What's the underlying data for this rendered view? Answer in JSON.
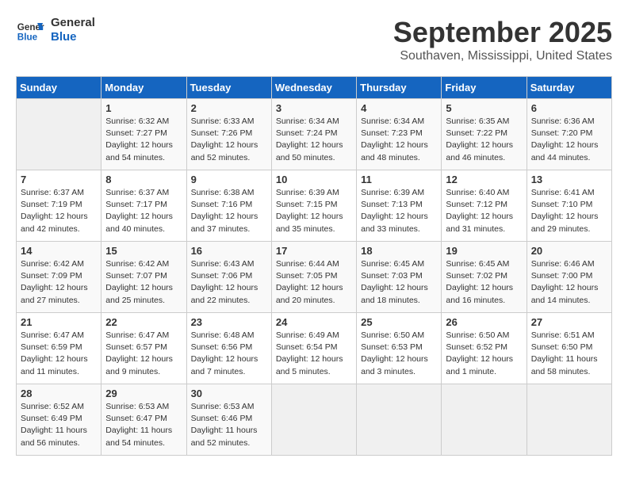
{
  "header": {
    "logo_line1": "General",
    "logo_line2": "Blue",
    "month": "September 2025",
    "location": "Southaven, Mississippi, United States"
  },
  "weekdays": [
    "Sunday",
    "Monday",
    "Tuesday",
    "Wednesday",
    "Thursday",
    "Friday",
    "Saturday"
  ],
  "weeks": [
    [
      {
        "day": "",
        "info": ""
      },
      {
        "day": "1",
        "info": "Sunrise: 6:32 AM\nSunset: 7:27 PM\nDaylight: 12 hours\nand 54 minutes."
      },
      {
        "day": "2",
        "info": "Sunrise: 6:33 AM\nSunset: 7:26 PM\nDaylight: 12 hours\nand 52 minutes."
      },
      {
        "day": "3",
        "info": "Sunrise: 6:34 AM\nSunset: 7:24 PM\nDaylight: 12 hours\nand 50 minutes."
      },
      {
        "day": "4",
        "info": "Sunrise: 6:34 AM\nSunset: 7:23 PM\nDaylight: 12 hours\nand 48 minutes."
      },
      {
        "day": "5",
        "info": "Sunrise: 6:35 AM\nSunset: 7:22 PM\nDaylight: 12 hours\nand 46 minutes."
      },
      {
        "day": "6",
        "info": "Sunrise: 6:36 AM\nSunset: 7:20 PM\nDaylight: 12 hours\nand 44 minutes."
      }
    ],
    [
      {
        "day": "7",
        "info": "Sunrise: 6:37 AM\nSunset: 7:19 PM\nDaylight: 12 hours\nand 42 minutes."
      },
      {
        "day": "8",
        "info": "Sunrise: 6:37 AM\nSunset: 7:17 PM\nDaylight: 12 hours\nand 40 minutes."
      },
      {
        "day": "9",
        "info": "Sunrise: 6:38 AM\nSunset: 7:16 PM\nDaylight: 12 hours\nand 37 minutes."
      },
      {
        "day": "10",
        "info": "Sunrise: 6:39 AM\nSunset: 7:15 PM\nDaylight: 12 hours\nand 35 minutes."
      },
      {
        "day": "11",
        "info": "Sunrise: 6:39 AM\nSunset: 7:13 PM\nDaylight: 12 hours\nand 33 minutes."
      },
      {
        "day": "12",
        "info": "Sunrise: 6:40 AM\nSunset: 7:12 PM\nDaylight: 12 hours\nand 31 minutes."
      },
      {
        "day": "13",
        "info": "Sunrise: 6:41 AM\nSunset: 7:10 PM\nDaylight: 12 hours\nand 29 minutes."
      }
    ],
    [
      {
        "day": "14",
        "info": "Sunrise: 6:42 AM\nSunset: 7:09 PM\nDaylight: 12 hours\nand 27 minutes."
      },
      {
        "day": "15",
        "info": "Sunrise: 6:42 AM\nSunset: 7:07 PM\nDaylight: 12 hours\nand 25 minutes."
      },
      {
        "day": "16",
        "info": "Sunrise: 6:43 AM\nSunset: 7:06 PM\nDaylight: 12 hours\nand 22 minutes."
      },
      {
        "day": "17",
        "info": "Sunrise: 6:44 AM\nSunset: 7:05 PM\nDaylight: 12 hours\nand 20 minutes."
      },
      {
        "day": "18",
        "info": "Sunrise: 6:45 AM\nSunset: 7:03 PM\nDaylight: 12 hours\nand 18 minutes."
      },
      {
        "day": "19",
        "info": "Sunrise: 6:45 AM\nSunset: 7:02 PM\nDaylight: 12 hours\nand 16 minutes."
      },
      {
        "day": "20",
        "info": "Sunrise: 6:46 AM\nSunset: 7:00 PM\nDaylight: 12 hours\nand 14 minutes."
      }
    ],
    [
      {
        "day": "21",
        "info": "Sunrise: 6:47 AM\nSunset: 6:59 PM\nDaylight: 12 hours\nand 11 minutes."
      },
      {
        "day": "22",
        "info": "Sunrise: 6:47 AM\nSunset: 6:57 PM\nDaylight: 12 hours\nand 9 minutes."
      },
      {
        "day": "23",
        "info": "Sunrise: 6:48 AM\nSunset: 6:56 PM\nDaylight: 12 hours\nand 7 minutes."
      },
      {
        "day": "24",
        "info": "Sunrise: 6:49 AM\nSunset: 6:54 PM\nDaylight: 12 hours\nand 5 minutes."
      },
      {
        "day": "25",
        "info": "Sunrise: 6:50 AM\nSunset: 6:53 PM\nDaylight: 12 hours\nand 3 minutes."
      },
      {
        "day": "26",
        "info": "Sunrise: 6:50 AM\nSunset: 6:52 PM\nDaylight: 12 hours\nand 1 minute."
      },
      {
        "day": "27",
        "info": "Sunrise: 6:51 AM\nSunset: 6:50 PM\nDaylight: 11 hours\nand 58 minutes."
      }
    ],
    [
      {
        "day": "28",
        "info": "Sunrise: 6:52 AM\nSunset: 6:49 PM\nDaylight: 11 hours\nand 56 minutes."
      },
      {
        "day": "29",
        "info": "Sunrise: 6:53 AM\nSunset: 6:47 PM\nDaylight: 11 hours\nand 54 minutes."
      },
      {
        "day": "30",
        "info": "Sunrise: 6:53 AM\nSunset: 6:46 PM\nDaylight: 11 hours\nand 52 minutes."
      },
      {
        "day": "",
        "info": ""
      },
      {
        "day": "",
        "info": ""
      },
      {
        "day": "",
        "info": ""
      },
      {
        "day": "",
        "info": ""
      }
    ]
  ]
}
